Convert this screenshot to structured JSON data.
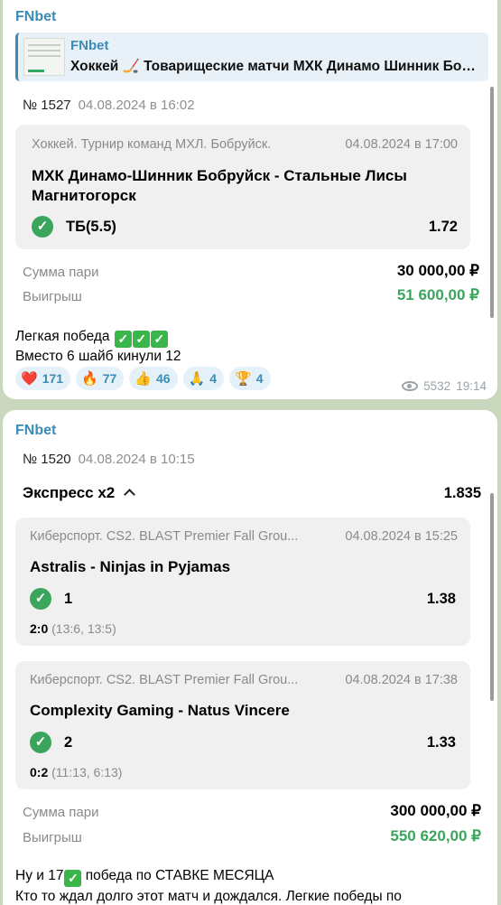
{
  "msg1": {
    "channel": "FNbet",
    "reply": {
      "name": "FNbet",
      "text": "Хоккей 🏒 Товарищеские матчи МХК Динамо Шинник Бобруйск"
    },
    "ticket": {
      "number": "№ 1527",
      "date": "04.08.2024 в 16:02",
      "event": {
        "tournament": "Хоккей. Турнир команд МХЛ. Бобруйск.",
        "datetime": "04.08.2024 в 17:00",
        "teams_line1": "МХК Динамо-Шинник Бобруйск - Стальные Лисы",
        "teams_line2": "Магнитогорск",
        "selection": "ТБ(5.5)",
        "odds": "1.72"
      },
      "stake_label": "Сумма пари",
      "stake": "30 000,00 ₽",
      "payout_label": "Выигрыш",
      "payout": "51 600,00 ₽"
    },
    "text_line1": "Легкая победа",
    "text_line2": "Вместо 6 шайб кинули 12",
    "reactions": [
      {
        "emoji": "❤️",
        "count": "171"
      },
      {
        "emoji": "🔥",
        "count": "77"
      },
      {
        "emoji": "👍",
        "count": "46"
      },
      {
        "emoji": "🙏",
        "count": "4"
      },
      {
        "emoji": "🏆",
        "count": "4"
      }
    ],
    "views": "5532",
    "time": "19:14"
  },
  "msg2": {
    "channel": "FNbet",
    "ticket": {
      "number": "№ 1520",
      "date": "04.08.2024 в 10:15",
      "express_label": "Экспресс x2",
      "express_odds": "1.835",
      "events": [
        {
          "tournament": "Киберспорт. CS2. BLAST Premier Fall Grou...",
          "datetime": "04.08.2024 в 15:25",
          "teams": "Astralis - Ninjas in Pyjamas",
          "selection": "1",
          "odds": "1.38",
          "score": "2:0",
          "score_detail": "(13:6, 13:5)"
        },
        {
          "tournament": "Киберспорт. CS2. BLAST Premier Fall Grou...",
          "datetime": "04.08.2024 в 17:38",
          "teams": "Complexity Gaming - Natus Vincere",
          "selection": "2",
          "odds": "1.33",
          "score": "0:2",
          "score_detail": "(11:13, 6:13)"
        }
      ],
      "stake_label": "Сумма пари",
      "stake": "300 000,00 ₽",
      "payout_label": "Выигрыш",
      "payout": "550 620,00 ₽"
    },
    "text_line1_a": "Ну и 17",
    "text_line1_b": " победа по СТАВКЕ МЕСЯЦА",
    "text_line2": "Кто то ждал долго этот матч и дождался. Легкие победы по"
  },
  "colors": {
    "accent": "#3a8bb5",
    "win": "#3ba55d",
    "background": "#c9d7bd"
  },
  "icons": {
    "check": "check-circle-icon",
    "views": "eye-icon",
    "expand": "chevron-up-icon"
  }
}
